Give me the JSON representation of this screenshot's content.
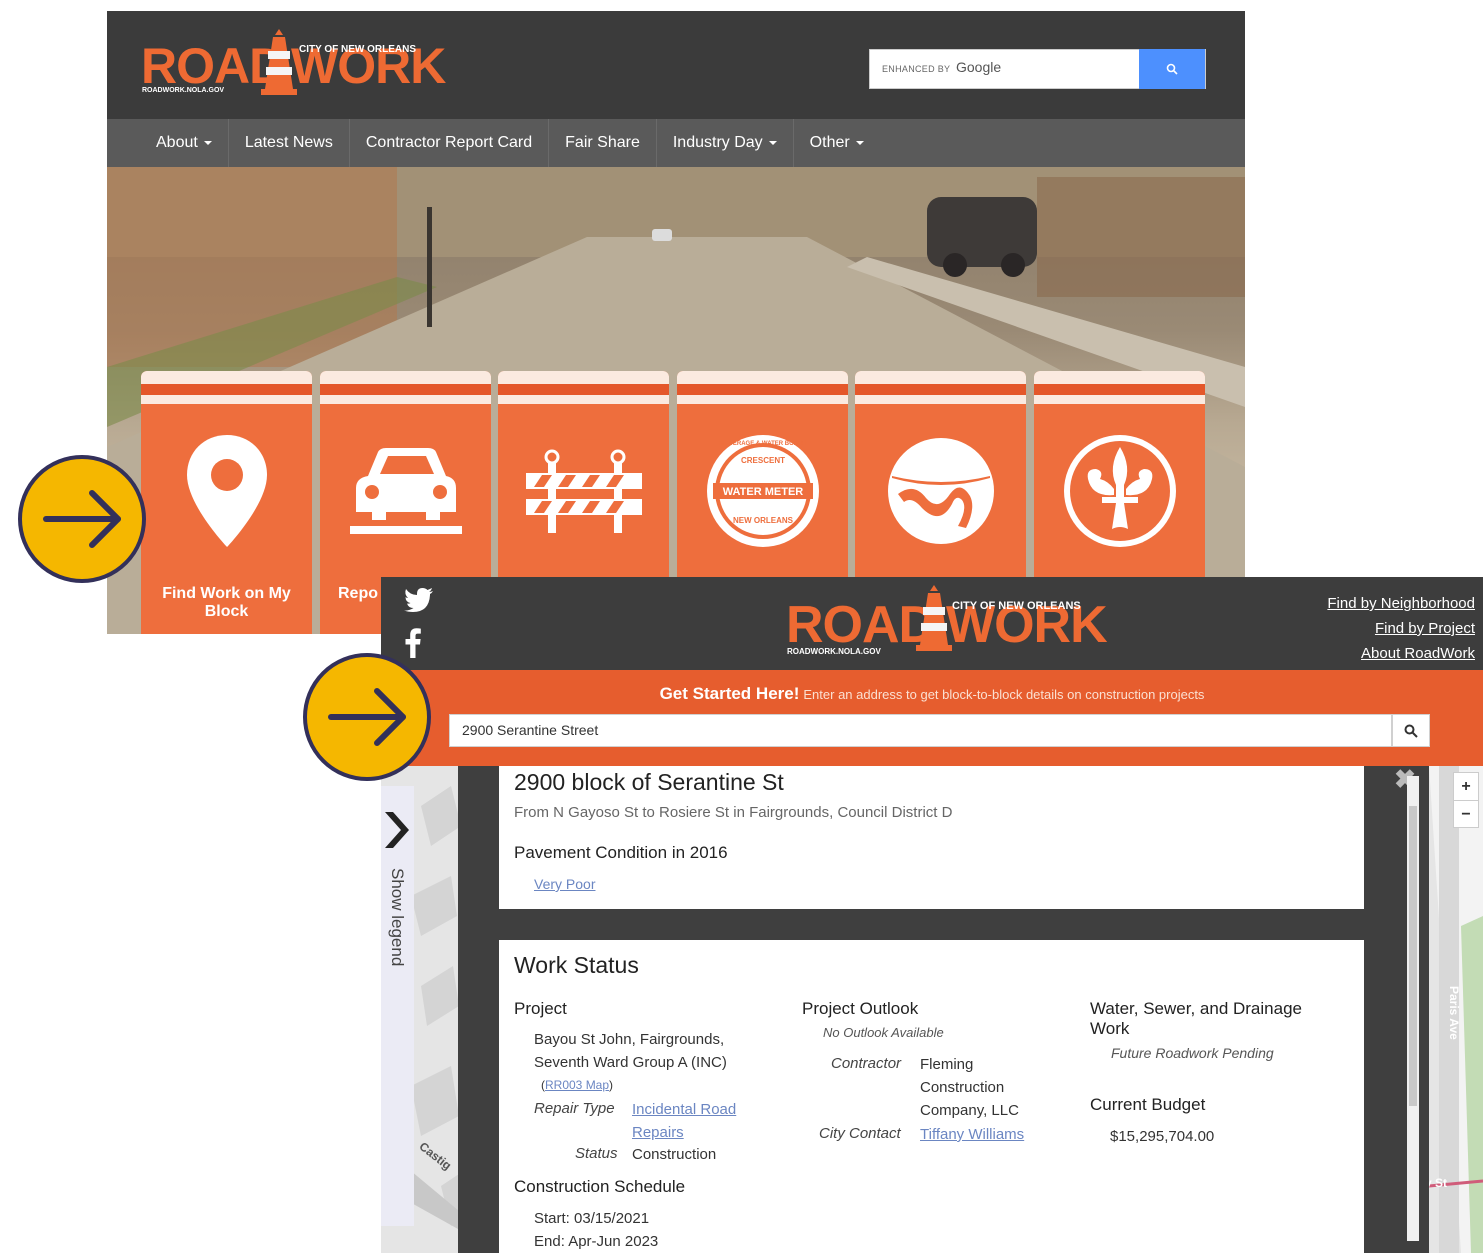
{
  "shot1": {
    "logo": {
      "road": "ROAD",
      "work": "WORK",
      "city": "CITY OF NEW ORLEANS",
      "url": "ROADWORK.NOLA.GOV"
    },
    "search": {
      "enhanced_by": "ENHANCED BY",
      "google": "Google",
      "icon": "search-icon"
    },
    "nav": [
      "About",
      "Latest News",
      "Contractor Report Card",
      "Fair Share",
      "Industry Day",
      "Other"
    ],
    "nav_has_caret": [
      true,
      false,
      false,
      false,
      true,
      true
    ],
    "tiles": [
      {
        "icon": "map-pin-icon",
        "label": "Find Work on My Block"
      },
      {
        "icon": "car-pothole-icon",
        "label": "Repo"
      },
      {
        "icon": "barricade-icon",
        "label": ""
      },
      {
        "icon": "water-meter-icon",
        "label": ""
      },
      {
        "icon": "drainage-icon",
        "label": ""
      },
      {
        "icon": "fleur-de-lis-icon",
        "label": ""
      }
    ],
    "water_meter_text": {
      "ring_top": "SEWERAGE & WATER BOARD",
      "inner": "CRESCENT",
      "center": "WATER METER",
      "bottom": "NEW ORLEANS"
    }
  },
  "shot2": {
    "social": [
      "twitter-icon",
      "facebook-icon"
    ],
    "logo": {
      "road": "ROAD",
      "work": "WORK",
      "city": "CITY OF NEW ORLEANS",
      "url": "ROADWORK.NOLA.GOV"
    },
    "links": [
      "Find by Neighborhood",
      "Find by Project",
      "About RoadWork"
    ],
    "get_started": {
      "strong": "Get Started Here!",
      "rest": "Enter an address to get block-to-block details on construction projects"
    },
    "address_value": "2900 Serantine Street",
    "legend_toggle": "Show legend",
    "zoom": {
      "in": "+",
      "out": "−"
    },
    "street_labels": {
      "paris": "Paris Ave",
      "castig": "Castig",
      "y_st": "y St"
    },
    "block": {
      "title": "2900 block of Serantine St",
      "subtitle": "From N Gayoso St to Rosiere St in Fairgrounds, Council District D",
      "pavement_heading": "Pavement Condition in 2016",
      "pavement_value": "Very Poor"
    },
    "work_status": {
      "heading": "Work Status",
      "project": {
        "heading": "Project",
        "name_line1": "Bayou St John, Fairgrounds,",
        "name_line2": "Seventh Ward Group A (INC)",
        "map_link": "RR003 Map",
        "repair_type_label": "Repair Type",
        "repair_type_line1": "Incidental Road",
        "repair_type_line2": "Repairs",
        "status_label": "Status",
        "status_value": "Construction"
      },
      "schedule": {
        "heading": "Construction Schedule",
        "start": "Start: 03/15/2021",
        "end": "End: Apr-Jun 2023"
      },
      "outlook": {
        "heading": "Project Outlook",
        "note": "No Outlook Available",
        "contractor_label": "Contractor",
        "contractor_line1": "Fleming",
        "contractor_line2": "Construction",
        "contractor_line3": "Company, LLC",
        "city_contact_label": "City Contact",
        "city_contact_value": "Tiffany Williams"
      },
      "water": {
        "heading_line1": "Water, Sewer, and Drainage",
        "heading_line2": "Work",
        "note": "Future Roadwork Pending"
      },
      "budget": {
        "heading": "Current Budget",
        "value": "$15,295,704.00"
      }
    }
  },
  "colors": {
    "orange": "#ee6e3d",
    "dark": "#3d3d3d",
    "nav_gray": "#5a5a5a",
    "callout_yellow": "#f5b700",
    "callout_navy": "#33305a",
    "google_blue": "#4d90fe"
  },
  "callouts": [
    "arrow-right-icon",
    "arrow-right-icon"
  ]
}
